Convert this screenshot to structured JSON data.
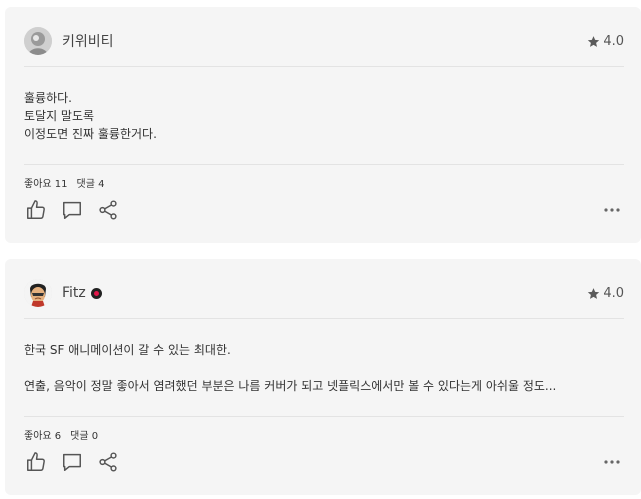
{
  "reviews": [
    {
      "user": "키위비티",
      "rating": "4.0",
      "vip": false,
      "lines": [
        "훌륭하다.",
        "토달지 말도록",
        "이정도면 진짜 훌륭한거다."
      ],
      "likes": "좋아요 11",
      "comments": "댓글 4"
    },
    {
      "user": "Fitz",
      "rating": "4.0",
      "vip": true,
      "lines": [
        "한국 SF 애니메이션이 갈 수 있는 최대한.",
        "",
        "연출, 음악이 정말 좋아서 염려했던 부분은 나름 커버가 되고 넷플릭스에서만 볼 수 있다는게 아쉬울 정도..."
      ],
      "likes": "좋아요 6",
      "comments": "댓글 0"
    }
  ],
  "icons": {
    "star": "star-icon",
    "like": "thumbs-up-icon",
    "comment": "speech-bubble-icon",
    "share": "share-icon",
    "more": "more-dots-icon"
  },
  "colors": {
    "card_bg": "#f5f5f5",
    "divider": "#e3e3e3",
    "vip_badge": "#e2174a"
  }
}
